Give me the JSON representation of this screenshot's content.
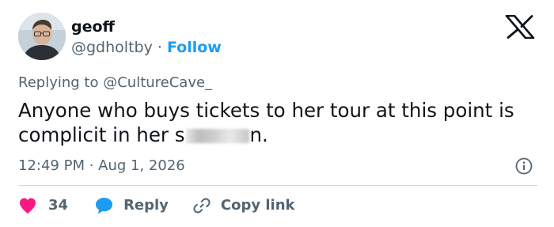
{
  "author": {
    "name": "geoff",
    "handle": "@gdholtby",
    "separator": "·",
    "follow_label": "Follow"
  },
  "brand_icon": "x-logo-icon",
  "reply_context": {
    "prefix": "Replying to",
    "mention": "@CultureCave_"
  },
  "tweet": {
    "text_before_redaction": "Anyone who buys tickets to her tour at this point is complicit in her s",
    "text_after_redaction": "n."
  },
  "timestamp": "12:49 PM · Aug 1, 2026",
  "actions": {
    "like_count": "34",
    "reply_label": "Reply",
    "copy_link_label": "Copy link"
  },
  "colors": {
    "accent": "#1d9bf0",
    "like": "#f91880",
    "text_primary": "#0f1419",
    "text_secondary": "#536471",
    "divider": "#cfd9de"
  }
}
